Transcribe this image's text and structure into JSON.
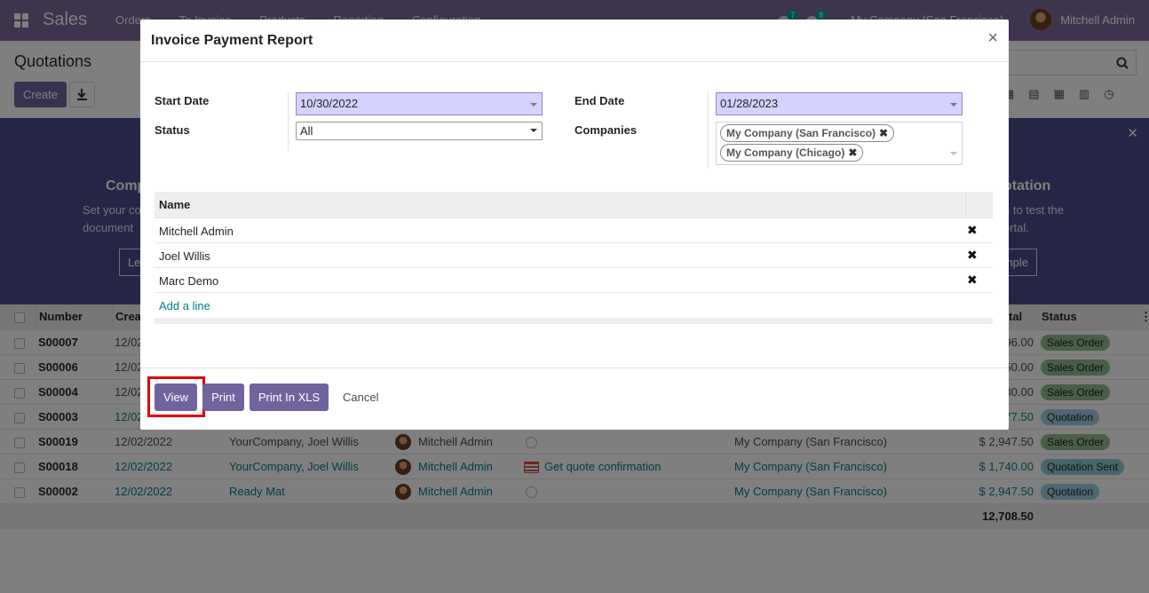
{
  "navbar": {
    "app_name": "Sales",
    "menu": [
      "Orders",
      "To Invoice",
      "Products",
      "Reporting",
      "Configuration"
    ],
    "badge_messages": "7",
    "badge_activities": "8",
    "company": "My Company (San Francisco)",
    "user": "Mitchell Admin"
  },
  "control_panel": {
    "title": "Quotations",
    "create_label": "Create"
  },
  "helper": {
    "left_title": "Comp",
    "left_text_1": "Set your co",
    "left_text_2": "document",
    "left_button": "Le",
    "right_title": "otation",
    "right_text_1": "n to test the",
    "right_text_2": "ortal.",
    "right_button": "mple"
  },
  "list": {
    "headers": {
      "number": "Number",
      "creation": "Crea",
      "total": "tal",
      "status": "Status"
    },
    "rows": [
      {
        "number": "S00007",
        "date": "12/02",
        "customer": "",
        "salesperson": "",
        "activity": "",
        "company": "",
        "total": "96.00",
        "status": "Sales Order",
        "status_kind": "so",
        "link": false,
        "hidden_mid": true
      },
      {
        "number": "S00006",
        "date": "12/02",
        "customer": "",
        "salesperson": "",
        "activity": "",
        "company": "",
        "total": "50.00",
        "status": "Sales Order",
        "status_kind": "so",
        "link": false,
        "hidden_mid": true
      },
      {
        "number": "S00004",
        "date": "12/02",
        "customer": "",
        "salesperson": "",
        "activity": "",
        "company": "",
        "total": "30.00",
        "status": "Sales Order",
        "status_kind": "so",
        "link": false,
        "hidden_mid": true
      },
      {
        "number": "S00003",
        "date": "12/02",
        "customer": "",
        "salesperson": "",
        "activity": "",
        "company": "",
        "total": "77.50",
        "status": "Quotation",
        "status_kind": "qu",
        "link": true,
        "hidden_mid": true
      },
      {
        "number": "S00019",
        "date": "12/02/2022",
        "customer": "YourCompany, Joel Willis",
        "salesperson": "Mitchell Admin",
        "activity": "",
        "company": "My Company (San Francisco)",
        "total": "$ 2,947.50",
        "status": "Sales Order",
        "status_kind": "so",
        "link": false,
        "hidden_mid": false
      },
      {
        "number": "S00018",
        "date": "12/02/2022",
        "customer": "YourCompany, Joel Willis",
        "salesperson": "Mitchell Admin",
        "activity": "Get quote confirmation",
        "company": "My Company (San Francisco)",
        "total": "$ 1,740.00",
        "status": "Quotation Sent",
        "status_kind": "qs",
        "link": true,
        "hidden_mid": false
      },
      {
        "number": "S00002",
        "date": "12/02/2022",
        "customer": "Ready Mat",
        "salesperson": "Mitchell Admin",
        "activity": "",
        "company": "My Company (San Francisco)",
        "total": "$ 2,947.50",
        "status": "Quotation",
        "status_kind": "qu",
        "link": true,
        "hidden_mid": false
      }
    ],
    "grand_total": "12,708.50"
  },
  "modal": {
    "title": "Invoice Payment Report",
    "start_date_label": "Start Date",
    "start_date": "10/30/2022",
    "end_date_label": "End Date",
    "end_date": "01/28/2023",
    "status_label": "Status",
    "status_value": "All",
    "companies_label": "Companies",
    "companies": [
      "My Company (San Francisco)",
      "My Company (Chicago)"
    ],
    "users_header": "Name",
    "users": [
      "Mitchell Admin",
      "Joel Willis",
      "Marc Demo"
    ],
    "add_line": "Add a line",
    "buttons": {
      "view": "View",
      "print": "Print",
      "print_xls": "Print In XLS",
      "cancel": "Cancel"
    }
  }
}
